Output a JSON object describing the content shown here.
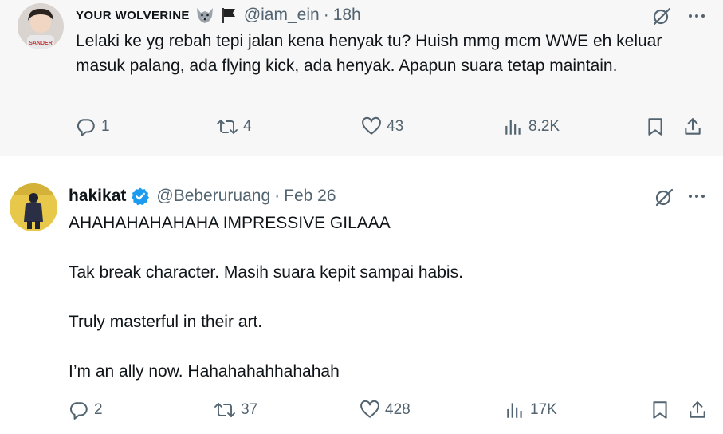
{
  "tweets": [
    {
      "name": "YOUR WOLVERINE",
      "name_emoji": [
        "wolf-emoji-icon",
        "black-flag-emoji-icon"
      ],
      "handle": "@iam_ein",
      "dot": "·",
      "time": "18h",
      "verified": false,
      "text": "Lelaki ke yg rebah tepi jalan kena henyak tu? Huish mmg mcm WWE eh keluar masuk palang, ada flying kick, ada henyak. Apapun suara tetap maintain.",
      "stats": {
        "replies": "1",
        "reposts": "4",
        "likes": "43",
        "views": "8.2K"
      }
    },
    {
      "name": "hakikat",
      "handle": "@Beberuruang",
      "dot": "·",
      "time": "Feb 26",
      "verified": true,
      "paragraphs": [
        "AHAHAHAHAHAHA IMPRESSIVE GILAAA",
        "Tak break character. Masih suara kepit sampai habis.",
        "Truly masterful in their art.",
        "I’m an ally now. Hahahahahhahahah"
      ],
      "stats": {
        "replies": "2",
        "reposts": "37",
        "likes": "428",
        "views": "17K"
      }
    }
  ],
  "colors": {
    "text": "#0f1419",
    "muted": "#536471",
    "verified": "#1d9bf0",
    "tweet1_bg": "#f7f7f7",
    "tweet2_bg": "#ffffff"
  },
  "icons": [
    "reply-icon",
    "repost-icon",
    "like-icon",
    "views-icon",
    "bookmark-icon",
    "share-icon",
    "grok-icon",
    "more-icon"
  ]
}
